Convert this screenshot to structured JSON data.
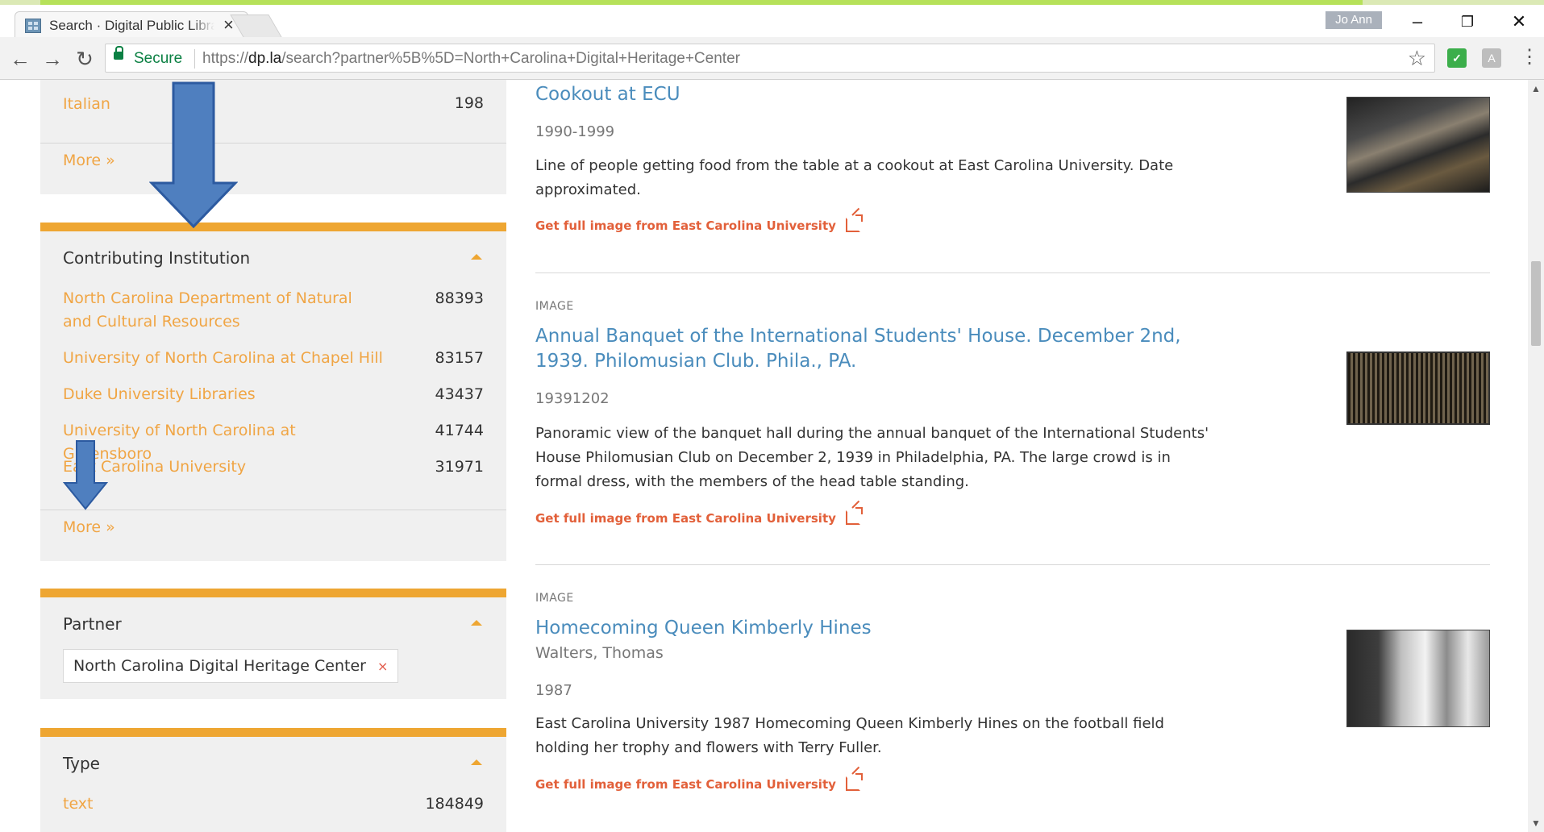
{
  "browser": {
    "tab_title": "Search · Digital Public Library of America",
    "tab_close": "×",
    "user_badge": "Jo Ann",
    "win_minimize": "–",
    "win_restore": "❐",
    "win_close": "✕",
    "nav_back": "←",
    "nav_forward": "→",
    "nav_reload": "↻",
    "secure_label": "Secure",
    "url_scheme": "https://",
    "url_host": "dp.la",
    "url_path": "/search?partner%5B%5D=North+Carolina+Digital+Heritage+Center",
    "bookmark_star": "☆",
    "menu": "⋮",
    "ext_a": "A"
  },
  "colors": {
    "accent_orange": "#eea632",
    "link_blue": "#4a8cbc",
    "facet_link": "#f0a544",
    "arrow_blue": "#4f7fbf"
  },
  "facets": {
    "language": {
      "items": [
        {
          "label": "Italian",
          "count": "198"
        }
      ],
      "more": "More »"
    },
    "institution": {
      "title": "Contributing Institution",
      "items": [
        {
          "label": "North Carolina Department of Natural and Cultural Resources",
          "count": "88393"
        },
        {
          "label": "University of North Carolina at Chapel Hill",
          "count": "83157"
        },
        {
          "label": "Duke University Libraries",
          "count": "43437"
        },
        {
          "label": "University of North Carolina at Greensboro",
          "count": "41744"
        },
        {
          "label": "East Carolina University",
          "count": "31971"
        }
      ],
      "more": "More »"
    },
    "partner": {
      "title": "Partner",
      "selected": "North Carolina Digital Heritage Center",
      "remove": "×"
    },
    "type": {
      "title": "Type",
      "items": [
        {
          "label": "text",
          "count": "184849"
        }
      ]
    }
  },
  "results": [
    {
      "title": "Cookout at ECU",
      "date": "1990-1999",
      "description": "Line of people getting food from the table at a cookout at East Carolina University. Date approximated.",
      "link": "Get full image from East Carolina University"
    },
    {
      "type": "IMAGE",
      "title": "Annual Banquet of the International Students' House. December 2nd, 1939. Philomusian Club. Phila., PA.",
      "date": "19391202",
      "description": "Panoramic view of the banquet hall during the annual banquet of the International Students' House Philomusian Club on December 2, 1939 in Philadelphia, PA. The large crowd is in formal dress, with the members of the head table standing.",
      "link": "Get full image from East Carolina University"
    },
    {
      "type": "IMAGE",
      "title": "Homecoming Queen Kimberly Hines",
      "creator": "Walters, Thomas",
      "date": "1987",
      "description": "East Carolina University 1987 Homecoming Queen Kimberly Hines on the football field holding her trophy and flowers with Terry Fuller.",
      "link": "Get full image from East Carolina University"
    }
  ]
}
